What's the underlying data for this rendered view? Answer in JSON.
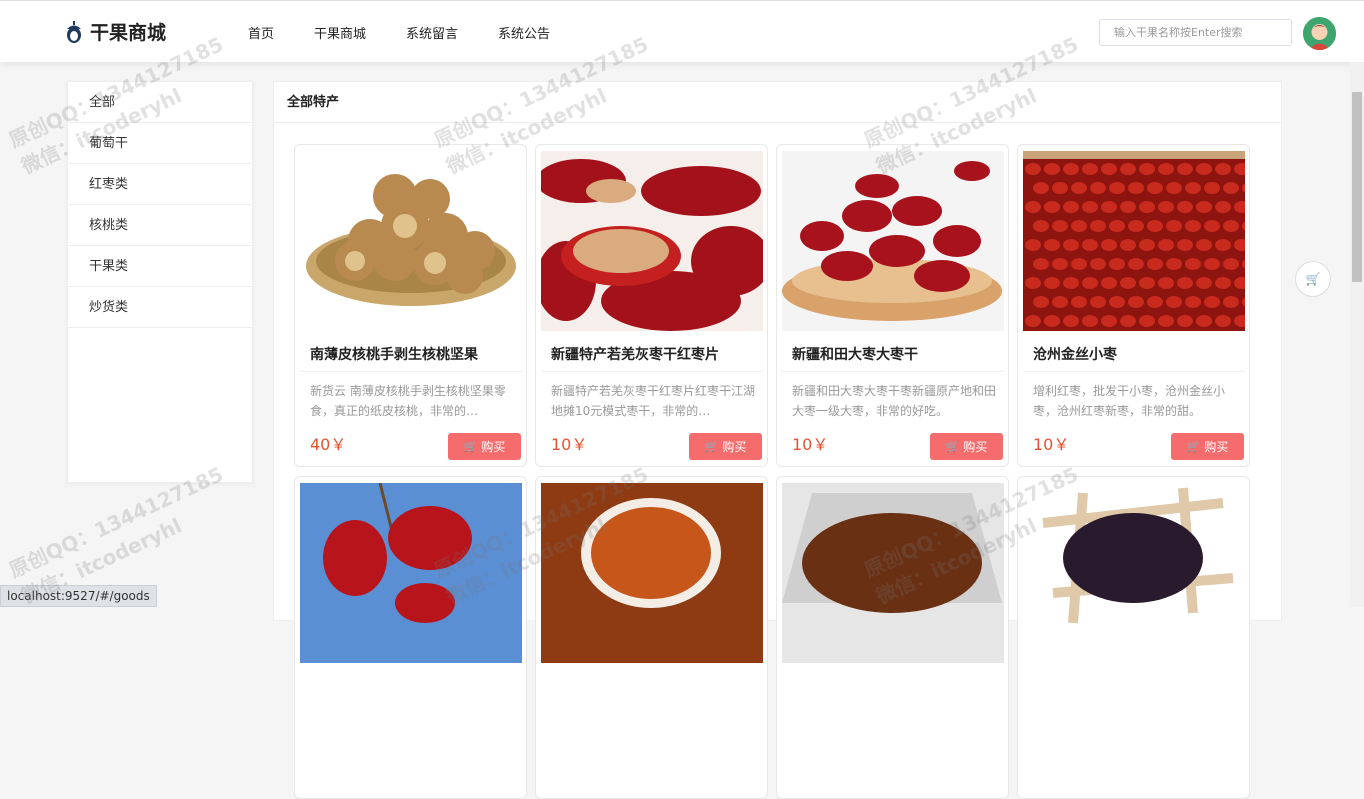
{
  "header": {
    "logo_text": "干果商城",
    "nav": [
      "首页",
      "干果商城",
      "系统留言",
      "系统公告"
    ],
    "search_placeholder": "输入干果名称按Enter搜索"
  },
  "sidebar": {
    "items": [
      "全部",
      "葡萄干",
      "红枣类",
      "核桃类",
      "干果类",
      "炒货类"
    ]
  },
  "main": {
    "title": "全部特产",
    "buy_label": "购买",
    "products": [
      {
        "name": "南薄皮核桃手剥生核桃坚果",
        "desc": "新货云 南薄皮核桃手剥生核桃坚果零食，真正的纸皮核桃，非常的…",
        "price": "40￥",
        "image": "walnuts"
      },
      {
        "name": "新疆特产若羌灰枣干红枣片",
        "desc": "新疆特产若羌灰枣干红枣片红枣干江湖地摊10元模式枣干，非常的…",
        "price": "10￥",
        "image": "date-slices"
      },
      {
        "name": "新疆和田大枣大枣干",
        "desc": "新疆和田大枣大枣干枣新疆原产地和田大枣一级大枣，非常的好吃。",
        "price": "10￥",
        "image": "dates-bowl"
      },
      {
        "name": "沧州金丝小枣",
        "desc": "增利红枣，批发干小枣，沧州金丝小枣，沧州红枣新枣，非常的甜。",
        "price": "10￥",
        "image": "small-dates"
      },
      {
        "name": "",
        "desc": "",
        "price": "",
        "image": "dates-branch"
      },
      {
        "name": "",
        "desc": "",
        "price": "",
        "image": "raisins-bowl"
      },
      {
        "name": "",
        "desc": "",
        "price": "",
        "image": "raisins-glass"
      },
      {
        "name": "",
        "desc": "",
        "price": "",
        "image": "black-raisins"
      }
    ]
  },
  "watermark": {
    "line1": "原创QQ：1344127185",
    "line2": "微信：itcoderyhl"
  },
  "status_bar": "localhost:9527/#/goods",
  "colors": {
    "price": "#e8522e",
    "buy_button": "#f56c6c"
  }
}
